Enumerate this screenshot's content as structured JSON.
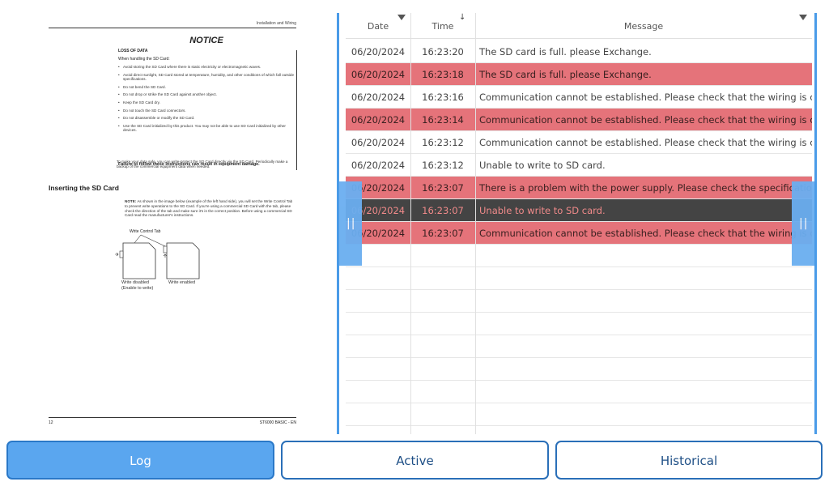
{
  "document": {
    "header_right": "Installation and Wiring",
    "notice_title": "NOTICE",
    "notice_subtitle": "LOSS OF DATA",
    "notice_intro": "When handling the SD Card:",
    "notice_items": [
      "Avoid storing the SD Card where there is static electricity or electromagnetic waves.",
      "Avoid direct sunlight, SD Card stored at temperature, humidity, and other conditions of which fall outside specifications.",
      "Do not bend the SD Card.",
      "Do not drop or strike the SD Card against another object.",
      "Keep the SD Card dry.",
      "Do not touch the SD Card connectors.",
      "Do not disassemble or modify the SD Card.",
      "Use the SD Card initialized by this product. You may not be able to use SD Card initialized by other devices."
    ],
    "notice_failure": "Failure to follow these instructions can result in equipment damage.",
    "paragraph": "To make your data safe, you can write-protect the SD Card directly via the SD Card. Periodically make a backup of the commercial equipment data when needed.",
    "section_title": "Inserting the SD Card",
    "note_label": "NOTE:",
    "note_text": "As shown in the image below (example of the left hand side), you will set the Write Control Tab to prevent write operations to the SD Card. If you're using a commercial SD Card with the tab, please check the direction of the tab and make sure it's in the correct position. Before using a commercial SD Card read the manufacturer's instructions.",
    "write_tab_label": "Write Control Tab",
    "card_left_label_1": "Write disabled",
    "card_left_label_2": "(Enable to write)",
    "card_right_label": "Write enabled",
    "footer_left": "12",
    "footer_right": "ST6000 BASIC - EN"
  },
  "log": {
    "columns": {
      "date": "Date",
      "time": "Time",
      "message": "Message"
    },
    "rows": [
      {
        "date": "06/20/2024",
        "time": "16:23:20",
        "message": "The SD card is full. please Exchange.",
        "state": "normal"
      },
      {
        "date": "06/20/2024",
        "time": "16:23:18",
        "message": "The SD card is full. please Exchange.",
        "state": "alarm"
      },
      {
        "date": "06/20/2024",
        "time": "16:23:16",
        "message": "Communication cannot be established. Please check that the wiring is correct.",
        "state": "normal"
      },
      {
        "date": "06/20/2024",
        "time": "16:23:14",
        "message": "Communication cannot be established. Please check that the wiring is correct.",
        "state": "alarm"
      },
      {
        "date": "06/20/2024",
        "time": "16:23:12",
        "message": "Communication cannot be established. Please check that the wiring is correct.",
        "state": "normal"
      },
      {
        "date": "06/20/2024",
        "time": "16:23:12",
        "message": "Unable to write to SD card.",
        "state": "normal"
      },
      {
        "date": "06/20/2024",
        "time": "16:23:07",
        "message": "There is a problem with the power supply. Please check the specifications.",
        "state": "alarm"
      },
      {
        "date": "06/20/2024",
        "time": "16:23:07",
        "message": "Unable to write to SD card.",
        "state": "selected"
      },
      {
        "date": "06/20/2024",
        "time": "16:23:07",
        "message": "Communication cannot be established. Please check that the wiring is correct.",
        "state": "alarm"
      }
    ],
    "empty_rows": 8,
    "handle_glyph": "||"
  },
  "buttons": {
    "log": "Log",
    "active": "Active",
    "historical": "Historical"
  },
  "colors": {
    "accent": "#4a9be8",
    "alarm_row": "#e5737a",
    "selected_row": "#444444",
    "selected_text": "#f08a8a"
  }
}
